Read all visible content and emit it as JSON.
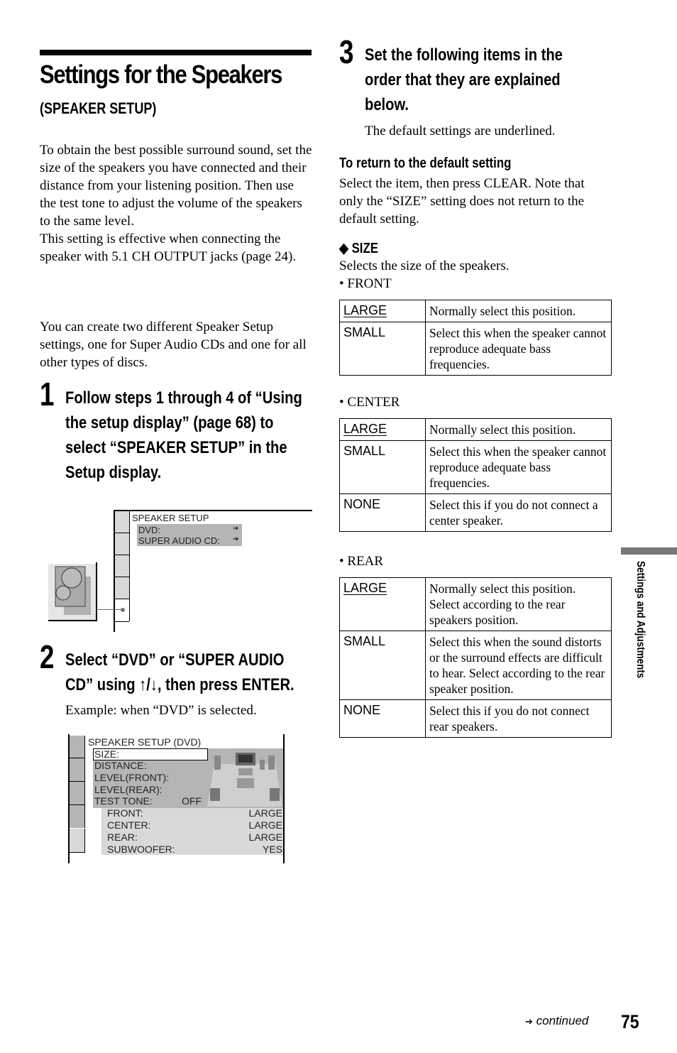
{
  "heading": {
    "title": "Settings for the Speakers",
    "subtitle": "(SPEAKER SETUP)"
  },
  "intro": {
    "paragraph1": "To obtain the best possible surround sound, set the size of the speakers you have connected and their distance from your listening position. Then use the test tone to adjust the volume of the speakers to the same level.",
    "paragraph1b": "This setting is effective when connecting the speaker with 5.1 CH OUTPUT jacks (page 24).",
    "paragraph2": "You can create two different Speaker Setup settings, one for Super Audio CDs and one for all other types of discs."
  },
  "steps": [
    {
      "number": "1",
      "text": "Follow steps 1 through 4 of “Using the setup display” (page 68) to select “SPEAKER SETUP” in the Setup display."
    },
    {
      "number": "2",
      "text": "Select “DVD” or “SUPER AUDIO CD” using ↑/↓, then press ENTER.",
      "note": "Example: when “DVD” is selected."
    },
    {
      "number": "3",
      "text": "Set the following items in the order that they are explained below.",
      "note": "The default settings are underlined."
    }
  ],
  "osd1": {
    "title": "SPEAKER SETUP",
    "items": [
      {
        "label": "DVD:",
        "arrow": "➔"
      },
      {
        "label": "SUPER AUDIO CD:",
        "arrow": "➔"
      }
    ]
  },
  "osd2": {
    "title": "SPEAKER SETUP (DVD)",
    "menu": [
      "SIZE:",
      "DISTANCE:",
      "LEVEL(FRONT):",
      "LEVEL(REAR):",
      "TEST TONE:"
    ],
    "test_tone_value": "OFF",
    "sub": [
      {
        "label": "FRONT:",
        "value": "LARGE"
      },
      {
        "label": "CENTER:",
        "value": "LARGE"
      },
      {
        "label": "REAR:",
        "value": "LARGE"
      },
      {
        "label": "SUBWOOFER:",
        "value": "YES"
      }
    ]
  },
  "return_default": {
    "heading": "To return to the default setting",
    "text": "Select the item, then press CLEAR. Note that only the “SIZE” setting does not return to the default setting."
  },
  "size": {
    "heading": "SIZE",
    "bullet_icon": "◆",
    "desc": "Selects the size of the speakers.",
    "front": {
      "label": "• FRONT",
      "rows": [
        {
          "key": "LARGE",
          "default": true,
          "value": "Normally select this position."
        },
        {
          "key": "SMALL",
          "default": false,
          "value": "Select this when the speaker cannot reproduce adequate bass frequencies."
        }
      ]
    },
    "center": {
      "label": "• CENTER",
      "rows": [
        {
          "key": "LARGE",
          "default": true,
          "value": "Normally select this position."
        },
        {
          "key": "SMALL",
          "default": false,
          "value": "Select this when the speaker cannot reproduce adequate bass frequencies."
        },
        {
          "key": "NONE",
          "default": false,
          "value": "Select this if you do not connect a center speaker."
        }
      ]
    },
    "rear": {
      "label": "• REAR",
      "rows": [
        {
          "key": "LARGE",
          "default": true,
          "value": "Normally select this position. Select according to the rear speakers position."
        },
        {
          "key": "SMALL",
          "default": false,
          "value": "Select this when the sound distorts or the surround effects are difficult to hear. Select according to the rear speaker position."
        },
        {
          "key": "NONE",
          "default": false,
          "value": "Select this if you do not connect rear speakers."
        }
      ]
    }
  },
  "sidebar": {
    "section": "Settings and Adjustments"
  },
  "footer": {
    "continued": "continued",
    "arrow": "➔",
    "page_number": "75"
  }
}
